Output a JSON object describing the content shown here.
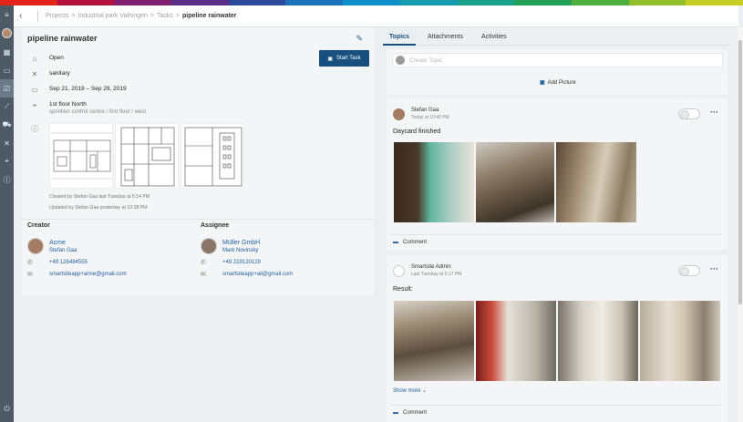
{
  "brand_colors": [
    "#e2231a",
    "#b5133e",
    "#7f1f6e",
    "#5a2d84",
    "#2c4a9a",
    "#1b72b9",
    "#0e8fc7",
    "#139bb0",
    "#17a28a",
    "#24a159",
    "#4fae3c",
    "#8fbf2a",
    "#c7cf24"
  ],
  "breadcrumb": {
    "back_icon": "chevron-left-icon",
    "items": [
      "Projects",
      "Industrial park Vaihingen",
      "Tasks"
    ],
    "separator": ">",
    "current": "pipeline rainwater"
  },
  "rail": {
    "icons": [
      "menu-icon",
      "avatar",
      "dashboard-icon",
      "folder-icon",
      "checklist-icon",
      "chart-icon",
      "vehicle-icon",
      "tools-icon",
      "location-icon",
      "info-icon"
    ],
    "bottom_icon": "logout-icon"
  },
  "task": {
    "title": "pipeline rainwater",
    "start_button": "Start Task",
    "status": "Open",
    "trade": "sanitary",
    "dates": "Sep 21, 2019 – Sep 29, 2019",
    "location": "1st floor North",
    "location_sub": "sprinkler control centre / first floor / west",
    "created": "Created by Stefan Gaa last Tuesday at 5:14 PM",
    "updated": "Updated by Stefan Gaa yesterday at 10:28 PM"
  },
  "creator": {
    "heading": "Creator",
    "company": "Acme",
    "person": "Stefan Gaa",
    "phone": "+49 126484555",
    "email": "smartsiteapp+anne@gmail.com"
  },
  "assignee": {
    "heading": "Assignee",
    "company": "Müller GmbH",
    "person": "Mark Novinsky",
    "phone": "+49 219120129",
    "email": "smartsiteapp+ali@gmail.com"
  },
  "tabs": [
    "Topics",
    "Attachments",
    "Activities"
  ],
  "new_topic": {
    "placeholder": "Create Topic",
    "add_picture": "Add Picture"
  },
  "posts": [
    {
      "author": "Stefan Gaa",
      "time": "Today at 10:40 PM",
      "text": "Daycard finished",
      "comment": "Comment"
    },
    {
      "author": "Smartsite Admin",
      "time": "Last Tuesday at 5:17 PM",
      "text": "Result:",
      "show_more": "Show more",
      "comment": "Comment"
    }
  ]
}
